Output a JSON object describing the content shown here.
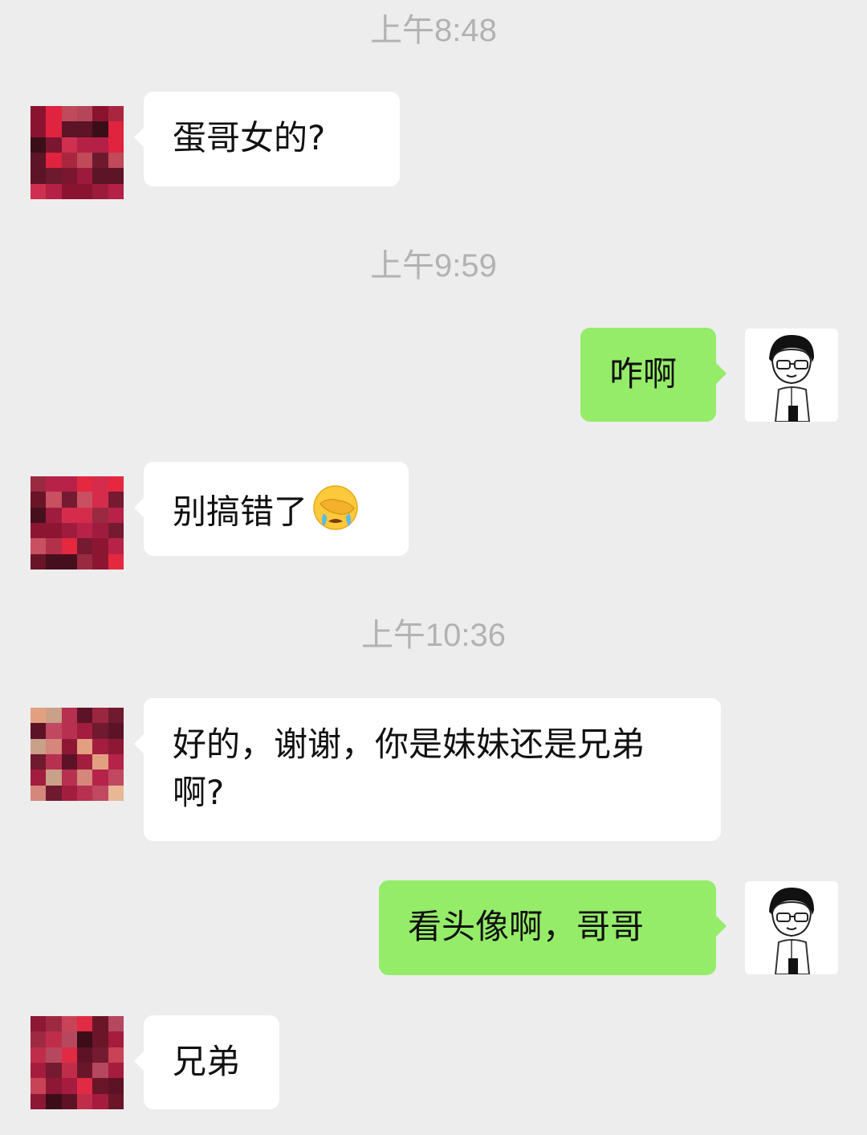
{
  "chat": {
    "timestamps": [
      "上午8:48",
      "上午9:59",
      "上午10:36"
    ],
    "messages": [
      {
        "side": "in",
        "text": "蛋哥女的?"
      },
      {
        "side": "out",
        "text": "咋啊"
      },
      {
        "side": "in",
        "text": "别搞错了",
        "emoji": "face-palm-crying-emoji"
      },
      {
        "side": "in",
        "text": "好的，谢谢，你是妹妹还是兄弟啊?"
      },
      {
        "side": "out",
        "text": "看头像啊，哥哥"
      },
      {
        "side": "in",
        "text": "兄弟"
      }
    ]
  },
  "avatars": {
    "contact": "pixelated-avatar",
    "self": "cartoon-man-with-glasses-avatar"
  },
  "colors": {
    "background": "#ededed",
    "incoming_bubble": "#ffffff",
    "outgoing_bubble": "#95ec69",
    "timestamp": "#b2b2b2"
  }
}
